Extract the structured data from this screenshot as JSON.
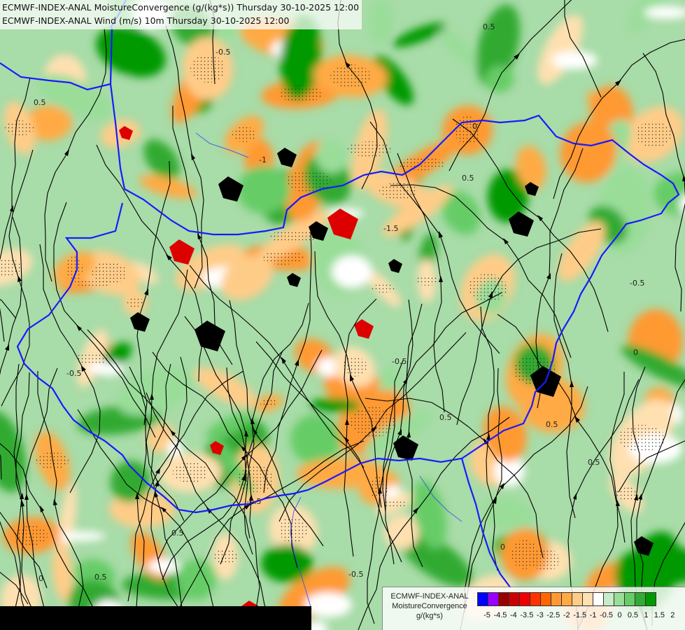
{
  "titles": {
    "line1": "ECMWF-INDEX-ANAL MoistureConvergence (g/(kg*s)) Thursday 30-10-2025 12:00",
    "line2": "ECMWF-INDEX-ANAL Wind (m/s) 10m Thursday 30-10-2025 12:00"
  },
  "legend": {
    "line1": "ECMWF-INDEX-ANAL",
    "line2": "MoistureConvergence",
    "line3": "g/(kg*s)",
    "colors": [
      "#0000ff",
      "#9900ff",
      "#990000",
      "#cc0000",
      "#ee0000",
      "#ff3300",
      "#ff6600",
      "#ff9933",
      "#ffaa44",
      "#ffcc88",
      "#ffe0b0",
      "#ffffff",
      "#c8ebc8",
      "#99dd99",
      "#66cc66",
      "#33aa33",
      "#009900"
    ],
    "ticks": [
      "-5",
      "-4.5",
      "-4",
      "-3.5",
      "-3",
      "-2.5",
      "-2",
      "-1.5",
      "-1",
      "-0.5",
      "0",
      "0.5",
      "1",
      "1.5",
      "2"
    ]
  },
  "contour_labels": [
    "0.5",
    "-0.5",
    "0.5",
    "0",
    "-1",
    "-1.5",
    "0.5",
    "-0.5",
    "0",
    "0.5",
    "-0.5",
    "0.5",
    "0",
    "-0.5",
    "0.5",
    "-0.5",
    "0.5",
    "0.5",
    "-0.5",
    "0"
  ]
}
